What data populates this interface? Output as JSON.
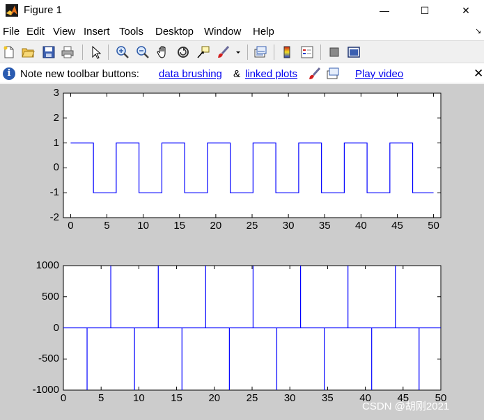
{
  "window": {
    "title": "Figure 1",
    "minimize_glyph": "—",
    "maximize_glyph": "☐",
    "close_glyph": "✕"
  },
  "menu": [
    "File",
    "Edit",
    "View",
    "Insert",
    "Tools",
    "Desktop",
    "Window",
    "Help"
  ],
  "menu_dock_glyph": "↘",
  "toolbar": {
    "icons": [
      "new-figure-icon",
      "open-file-icon",
      "save-icon",
      "print-icon",
      "edit-plot-arrow-icon",
      "zoom-in-icon",
      "zoom-out-icon",
      "pan-hand-icon",
      "rotate-3d-icon",
      "data-cursor-icon",
      "brush-icon",
      "brush-dropdown-icon",
      "link-plot-icon",
      "insert-colorbar-icon",
      "insert-legend-icon",
      "hide-plot-tools-icon",
      "show-plot-tools-icon"
    ]
  },
  "infobar": {
    "note": "Note new toolbar buttons:",
    "link_brushing": "data brushing",
    "amp": "&",
    "link_linked": "linked plots",
    "link_video": "Play video",
    "close_glyph": "✕"
  },
  "colors": {
    "figure_bg": "#cccccc",
    "axes_bg": "#ffffff",
    "line": "#0000ff",
    "link": "#0000ee"
  },
  "watermark": "CSDN @胡刚2021",
  "chart_data": [
    {
      "type": "line",
      "title": "",
      "xlabel": "",
      "ylabel": "",
      "xlim": [
        -1,
        51
      ],
      "ylim": [
        -2,
        3
      ],
      "xticks": [
        0,
        5,
        10,
        15,
        20,
        25,
        30,
        35,
        40,
        45,
        50
      ],
      "yticks": [
        -2,
        -1,
        0,
        1,
        2,
        3
      ],
      "grid": false,
      "series": [
        {
          "style": "step",
          "x": [
            0,
            3.14,
            3.14,
            6.28,
            6.28,
            9.42,
            9.42,
            12.57,
            12.57,
            15.71,
            15.71,
            18.85,
            18.85,
            21.99,
            21.99,
            25.13,
            25.13,
            28.27,
            28.27,
            31.42,
            31.42,
            34.56,
            34.56,
            37.7,
            37.7,
            40.84,
            40.84,
            43.98,
            43.98,
            47.12,
            47.12,
            50
          ],
          "y": [
            1,
            1,
            -1,
            -1,
            1,
            1,
            -1,
            -1,
            1,
            1,
            -1,
            -1,
            1,
            1,
            -1,
            -1,
            1,
            1,
            -1,
            -1,
            1,
            1,
            -1,
            -1,
            1,
            1,
            -1,
            -1,
            1,
            1,
            -1,
            -1
          ]
        }
      ]
    },
    {
      "type": "line",
      "title": "",
      "xlabel": "",
      "ylabel": "",
      "xlim": [
        0,
        50
      ],
      "ylim": [
        -1000,
        1000
      ],
      "xticks": [
        0,
        5,
        10,
        15,
        20,
        25,
        30,
        35,
        40,
        45,
        50
      ],
      "yticks": [
        -1000,
        -500,
        0,
        500,
        1000
      ],
      "grid": false,
      "baseline": 0,
      "series": [
        {
          "style": "impulses",
          "x": [
            3.14,
            6.28,
            9.42,
            12.57,
            15.71,
            18.85,
            21.99,
            25.13,
            28.27,
            31.42,
            34.56,
            37.7,
            40.84,
            43.98,
            47.12
          ],
          "y": [
            -1000,
            1000,
            -1000,
            1000,
            -1000,
            1000,
            -1000,
            1000,
            -1000,
            1000,
            -1000,
            1000,
            -1000,
            1000,
            -1000
          ]
        }
      ]
    }
  ]
}
